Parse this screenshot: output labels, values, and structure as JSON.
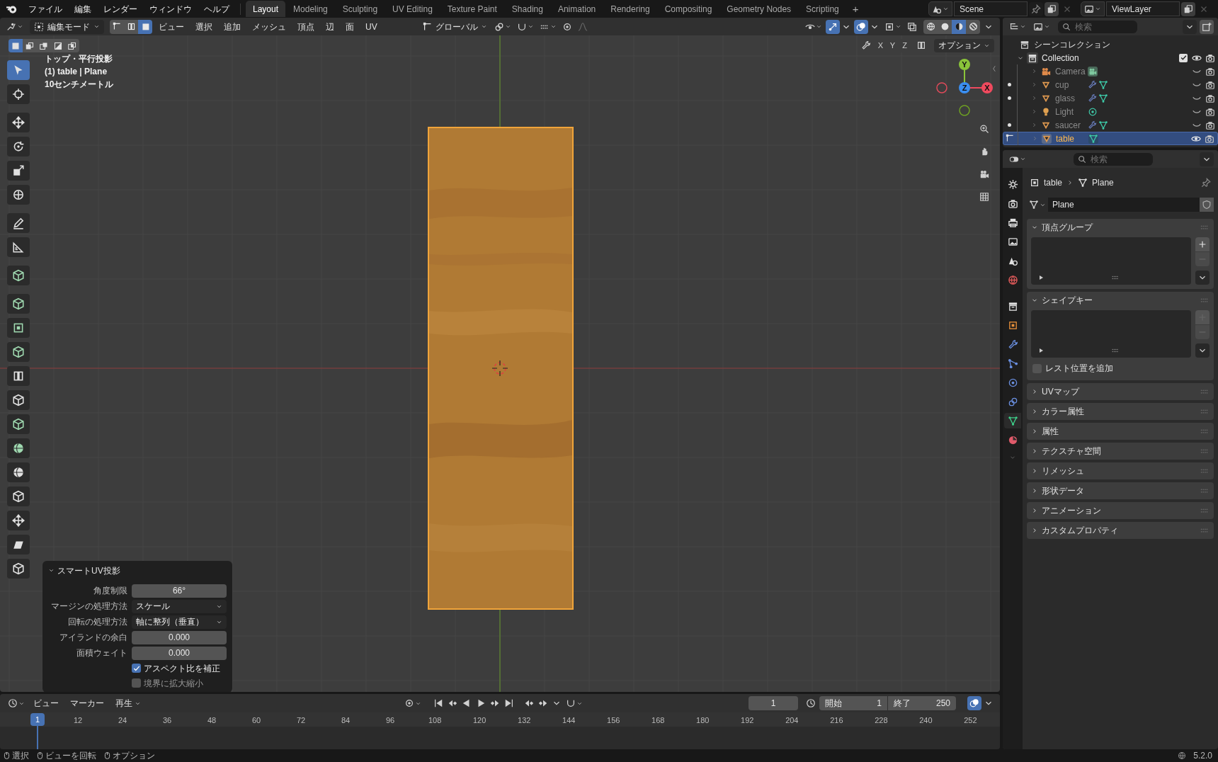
{
  "top_bar": {
    "menus": [
      "ファイル",
      "編集",
      "レンダー",
      "ウィンドウ",
      "ヘルプ"
    ],
    "workspaces": [
      {
        "label": "Layout",
        "selected": true
      },
      {
        "label": "Modeling",
        "selected": false
      },
      {
        "label": "Sculpting",
        "selected": false
      },
      {
        "label": "UV Editing",
        "selected": false
      },
      {
        "label": "Texture Paint",
        "selected": false
      },
      {
        "label": "Shading",
        "selected": false
      },
      {
        "label": "Animation",
        "selected": false
      },
      {
        "label": "Rendering",
        "selected": false
      },
      {
        "label": "Compositing",
        "selected": false
      },
      {
        "label": "Geometry Nodes",
        "selected": false
      },
      {
        "label": "Scripting",
        "selected": false
      }
    ],
    "add_workspace": "+",
    "scene": "Scene",
    "view_layer": "ViewLayer"
  },
  "viewport_header": {
    "mode": "編集モード",
    "select_modes": [
      {
        "selected": false
      },
      {
        "selected": false
      },
      {
        "selected": true
      }
    ],
    "menus": [
      "ビュー",
      "選択",
      "追加",
      "メッシュ",
      "頂点",
      "辺",
      "面",
      "UV"
    ],
    "orientation": "グローバル",
    "shading": [
      {
        "selected": false
      },
      {
        "selected": false
      },
      {
        "selected": true
      },
      {
        "selected": false
      }
    ]
  },
  "viewport": {
    "selection_ops": [
      {
        "selected": true
      },
      {
        "selected": false
      },
      {
        "selected": false
      },
      {
        "selected": false
      },
      {
        "selected": false
      }
    ],
    "mirror_axes": [
      "X",
      "Y",
      "Z"
    ],
    "options": "オプション",
    "overlay_text": [
      "トップ・平行投影",
      "(1) table | Plane",
      "10センチメートル"
    ],
    "gizmo_axes": [
      "Y",
      "Z",
      "X"
    ]
  },
  "toolbar": {
    "tools": [
      {
        "selected": true
      },
      {
        "selected": false
      },
      {
        "selected": false
      },
      {
        "selected": false
      },
      {
        "selected": false
      },
      {
        "selected": false
      },
      {
        "selected": false
      },
      {
        "selected": false
      },
      {
        "selected": false
      },
      {
        "selected": false
      },
      {
        "selected": false
      },
      {
        "selected": false
      },
      {
        "selected": false
      },
      {
        "selected": false
      },
      {
        "selected": false
      },
      {
        "selected": false
      },
      {
        "selected": false
      },
      {
        "selected": false
      },
      {
        "selected": false
      },
      {
        "selected": false
      },
      {
        "selected": false
      }
    ]
  },
  "redo_panel": {
    "title": "スマートUV投影",
    "fields": [
      {
        "kind": "number",
        "label": "角度制限",
        "value": "66°"
      },
      {
        "kind": "dropdown",
        "label": "マージンの処理方法",
        "value": "スケール"
      },
      {
        "kind": "dropdown",
        "label": "回転の処理方法",
        "value": "軸に整列（垂直）"
      },
      {
        "kind": "number",
        "label": "アイランドの余白",
        "value": "0.000"
      },
      {
        "kind": "number",
        "label": "面積ウェイト",
        "value": "0.000"
      },
      {
        "kind": "checkbox",
        "label": "アスペクト比を補正",
        "checked": true
      },
      {
        "kind": "checkbox",
        "label": "境界に拡大縮小",
        "checked": false
      }
    ]
  },
  "outliner": {
    "search_placeholder": "検索",
    "root": "シーンコレクション",
    "collection": {
      "label": "Collection",
      "checked": true
    },
    "items": [
      {
        "label": "Camera",
        "kind": "camera",
        "selected": false,
        "edit_dot": false,
        "modifier": false,
        "visible": false
      },
      {
        "label": "cup",
        "kind": "mesh",
        "selected": false,
        "edit_dot": true,
        "modifier": true,
        "visible": false
      },
      {
        "label": "glass",
        "kind": "mesh",
        "selected": false,
        "edit_dot": true,
        "modifier": true,
        "visible": false
      },
      {
        "label": "Light",
        "kind": "light",
        "selected": false,
        "edit_dot": false,
        "modifier": false,
        "visible": false
      },
      {
        "label": "saucer",
        "kind": "mesh",
        "selected": false,
        "edit_dot": true,
        "modifier": true,
        "visible": false
      },
      {
        "label": "table",
        "kind": "mesh",
        "selected": true,
        "edit_dot": false,
        "modifier": false,
        "visible": true
      }
    ]
  },
  "properties": {
    "search_placeholder": "検索",
    "tabs": [
      {
        "selected": false
      },
      {
        "selected": false
      },
      {
        "selected": false
      },
      {
        "selected": false
      },
      {
        "selected": false
      },
      {
        "selected": false
      },
      {
        "selected": false
      },
      {
        "selected": false
      },
      {
        "selected": false
      },
      {
        "selected": false
      },
      {
        "selected": false
      },
      {
        "selected": false
      },
      {
        "selected": true
      },
      {
        "selected": false
      }
    ],
    "breadcrumb": [
      "table",
      "Plane"
    ],
    "mesh_name": "Plane",
    "panels": [
      {
        "title": "頂点グループ",
        "expanded": true,
        "kind": "list"
      },
      {
        "title": "シェイプキー",
        "expanded": true,
        "kind": "list",
        "checkbox": {
          "label": "レスト位置を追加",
          "checked": false
        }
      },
      {
        "title": "UVマップ",
        "expanded": false
      },
      {
        "title": "カラー属性",
        "expanded": false
      },
      {
        "title": "属性",
        "expanded": false
      },
      {
        "title": "テクスチャ空間",
        "expanded": false
      },
      {
        "title": "リメッシュ",
        "expanded": false
      },
      {
        "title": "形状データ",
        "expanded": false
      },
      {
        "title": "アニメーション",
        "expanded": false
      },
      {
        "title": "カスタムプロパティ",
        "expanded": false
      }
    ]
  },
  "timeline": {
    "menus": [
      "ビュー",
      "マーカー",
      "再生"
    ],
    "current_frame": "1",
    "frame_field": "1",
    "start_label": "開始",
    "start": "1",
    "end_label": "終了",
    "end": "250",
    "ticks": [
      "12",
      "24",
      "36",
      "48",
      "60",
      "72",
      "84",
      "96",
      "108",
      "120",
      "132",
      "144",
      "156",
      "168",
      "180",
      "192",
      "204",
      "216",
      "228",
      "240",
      "252"
    ]
  },
  "status_bar": {
    "hints": [
      "選択",
      "ビューを回転",
      "オプション"
    ],
    "version": "5.2.0"
  }
}
